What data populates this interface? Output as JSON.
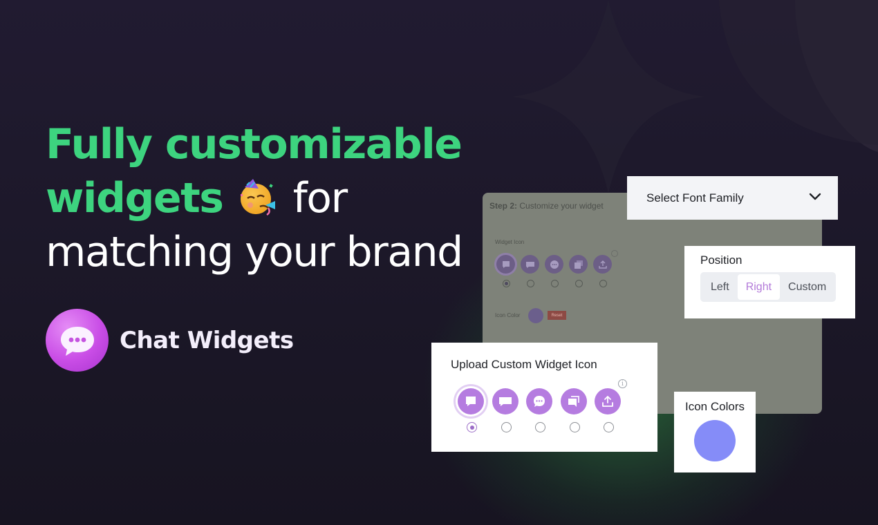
{
  "headline": {
    "line1": "Fully customizable",
    "line2_green": "widgets",
    "line2_white": "for",
    "line3": "matching your brand",
    "emoji_icon": "partying-face-emoji"
  },
  "brand": {
    "name": "Chat Widgets",
    "logo_icon": "speech-bubble-dots-icon"
  },
  "background_panel": {
    "step_prefix": "Step 2:",
    "step_text": "Customize your widget",
    "widget_icon_label": "Widget Icon",
    "icon_color_label": "Icon Color",
    "reset_label": "Reset"
  },
  "font_family": {
    "label": "Select Font Family",
    "icon": "chevron-down-icon"
  },
  "position": {
    "title": "Position",
    "options": [
      "Left",
      "Right",
      "Custom"
    ],
    "selected": "Right"
  },
  "upload_icon": {
    "title": "Upload Custom Widget Icon",
    "icons": [
      "chat-square-icon",
      "chat-rect-icon",
      "chat-dots-icon",
      "chat-stack-icon",
      "upload-icon"
    ],
    "selected_index": 0
  },
  "icon_colors": {
    "title": "Icon Colors",
    "swatch_color": "#858cf8"
  },
  "colors": {
    "accent_green": "#3dd47f",
    "accent_purple": "#b57ce0"
  }
}
